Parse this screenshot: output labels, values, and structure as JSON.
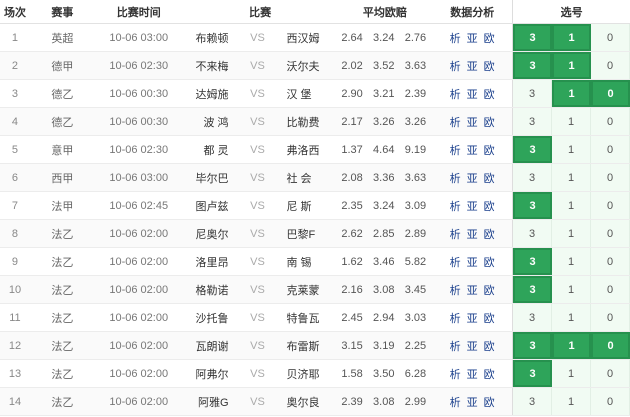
{
  "header": {
    "no": "场次",
    "league": "赛事",
    "time": "比赛时间",
    "match": "比赛",
    "odds": "平均欧赔",
    "analysis": "数据分析",
    "picks": "选号"
  },
  "vs_label": "VS",
  "analysis_links": [
    "析",
    "亚",
    "欧"
  ],
  "colors": {
    "selected": "#2ea45a",
    "link": "#1a3f8c",
    "pick_bg": "#f1fbf3"
  },
  "rows": [
    {
      "no": "1",
      "league": "英超",
      "time": "10-06 03:00",
      "home": "布赖顿",
      "away": "西汉姆",
      "odds": [
        "2.64",
        "3.24",
        "2.76"
      ],
      "picks": [
        "3",
        "1",
        "0"
      ],
      "sel": [
        true,
        true,
        false
      ]
    },
    {
      "no": "2",
      "league": "德甲",
      "time": "10-06 02:30",
      "home": "不来梅",
      "away": "沃尔夫",
      "odds": [
        "2.02",
        "3.52",
        "3.63"
      ],
      "picks": [
        "3",
        "1",
        "0"
      ],
      "sel": [
        true,
        true,
        false
      ]
    },
    {
      "no": "3",
      "league": "德乙",
      "time": "10-06 00:30",
      "home": "达姆施",
      "away": "汉 堡",
      "odds": [
        "2.90",
        "3.21",
        "2.39"
      ],
      "picks": [
        "3",
        "1",
        "0"
      ],
      "sel": [
        false,
        true,
        true
      ]
    },
    {
      "no": "4",
      "league": "德乙",
      "time": "10-06 00:30",
      "home": "波 鸿",
      "away": "比勒费",
      "odds": [
        "2.17",
        "3.26",
        "3.26"
      ],
      "picks": [
        "3",
        "1",
        "0"
      ],
      "sel": [
        false,
        false,
        false
      ]
    },
    {
      "no": "5",
      "league": "意甲",
      "time": "10-06 02:30",
      "home": "都 灵",
      "away": "弗洛西",
      "odds": [
        "1.37",
        "4.64",
        "9.19"
      ],
      "picks": [
        "3",
        "1",
        "0"
      ],
      "sel": [
        true,
        false,
        false
      ]
    },
    {
      "no": "6",
      "league": "西甲",
      "time": "10-06 03:00",
      "home": "毕尔巴",
      "away": "社 会",
      "odds": [
        "2.08",
        "3.36",
        "3.63"
      ],
      "picks": [
        "3",
        "1",
        "0"
      ],
      "sel": [
        false,
        false,
        false
      ]
    },
    {
      "no": "7",
      "league": "法甲",
      "time": "10-06 02:45",
      "home": "图卢兹",
      "away": "尼 斯",
      "odds": [
        "2.35",
        "3.24",
        "3.09"
      ],
      "picks": [
        "3",
        "1",
        "0"
      ],
      "sel": [
        true,
        false,
        false
      ]
    },
    {
      "no": "8",
      "league": "法乙",
      "time": "10-06 02:00",
      "home": "尼奥尔",
      "away": "巴黎F",
      "odds": [
        "2.62",
        "2.85",
        "2.89"
      ],
      "picks": [
        "3",
        "1",
        "0"
      ],
      "sel": [
        false,
        false,
        false
      ]
    },
    {
      "no": "9",
      "league": "法乙",
      "time": "10-06 02:00",
      "home": "洛里昂",
      "away": "南 锡",
      "odds": [
        "1.62",
        "3.46",
        "5.82"
      ],
      "picks": [
        "3",
        "1",
        "0"
      ],
      "sel": [
        true,
        false,
        false
      ]
    },
    {
      "no": "10",
      "league": "法乙",
      "time": "10-06 02:00",
      "home": "格勒诺",
      "away": "克莱蒙",
      "odds": [
        "2.16",
        "3.08",
        "3.45"
      ],
      "picks": [
        "3",
        "1",
        "0"
      ],
      "sel": [
        true,
        false,
        false
      ]
    },
    {
      "no": "11",
      "league": "法乙",
      "time": "10-06 02:00",
      "home": "沙托鲁",
      "away": "特鲁瓦",
      "odds": [
        "2.45",
        "2.94",
        "3.03"
      ],
      "picks": [
        "3",
        "1",
        "0"
      ],
      "sel": [
        false,
        false,
        false
      ]
    },
    {
      "no": "12",
      "league": "法乙",
      "time": "10-06 02:00",
      "home": "瓦朗谢",
      "away": "布雷斯",
      "odds": [
        "3.15",
        "3.19",
        "2.25"
      ],
      "picks": [
        "3",
        "1",
        "0"
      ],
      "sel": [
        true,
        true,
        true
      ]
    },
    {
      "no": "13",
      "league": "法乙",
      "time": "10-06 02:00",
      "home": "阿弗尔",
      "away": "贝济耶",
      "odds": [
        "1.58",
        "3.50",
        "6.28"
      ],
      "picks": [
        "3",
        "1",
        "0"
      ],
      "sel": [
        true,
        false,
        false
      ]
    },
    {
      "no": "14",
      "league": "法乙",
      "time": "10-06 02:00",
      "home": "阿雅G",
      "away": "奥尔良",
      "odds": [
        "2.39",
        "3.08",
        "2.99"
      ],
      "picks": [
        "3",
        "1",
        "0"
      ],
      "sel": [
        false,
        false,
        false
      ]
    }
  ]
}
